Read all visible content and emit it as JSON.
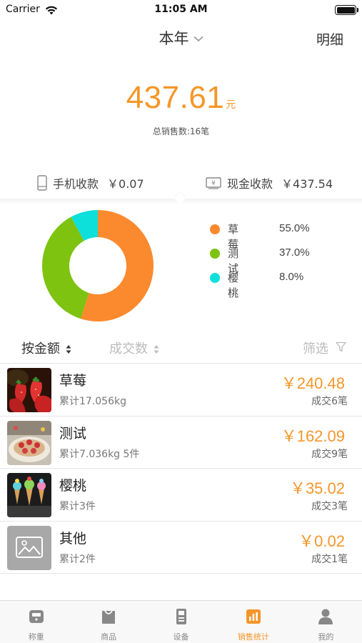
{
  "status_bar": {
    "carrier": "Carrier",
    "time": "11:05 AM"
  },
  "nav": {
    "period": "本年",
    "detail": "明细"
  },
  "summary": {
    "amount": "437.61",
    "unit": "元",
    "total_count": "总销售数:16笔"
  },
  "payments": {
    "mobile_label": "手机收款",
    "mobile_value": "￥0.07",
    "cash_label": "现金收款",
    "cash_value": "￥437.54"
  },
  "chart_data": {
    "type": "pie",
    "categories": [
      "草莓",
      "测试",
      "樱桃"
    ],
    "values": [
      55.0,
      37.0,
      8.0
    ],
    "labels": [
      "55.0%",
      "37.0%",
      "8.0%"
    ],
    "colors": [
      "#fb8a2e",
      "#7dc30f",
      "#0ddfdb"
    ],
    "title": "",
    "legend_position": "right"
  },
  "sort": {
    "by_amount": "按金额",
    "by_count": "成交数",
    "filter": "筛选"
  },
  "products": [
    {
      "name": "草莓",
      "sub": "累计17.056kg",
      "amount": "￥240.48",
      "deals": "成交6笔"
    },
    {
      "name": "测试",
      "sub": "累计7.036kg 5件",
      "amount": "￥162.09",
      "deals": "成交9笔"
    },
    {
      "name": "樱桃",
      "sub": "累计3件",
      "amount": "￥35.02",
      "deals": "成交3笔"
    },
    {
      "name": "其他",
      "sub": "累计2件",
      "amount": "￥0.02",
      "deals": "成交1笔"
    }
  ],
  "tabs": [
    {
      "label": "称重",
      "icon": "scale-icon"
    },
    {
      "label": "商品",
      "icon": "bag-icon"
    },
    {
      "label": "设备",
      "icon": "device-icon"
    },
    {
      "label": "销售统计",
      "icon": "bar-chart-icon",
      "active": true
    },
    {
      "label": "我的",
      "icon": "person-icon"
    }
  ],
  "colors": {
    "accent": "#f5962a",
    "text": "#333333",
    "muted": "#bbbbbb"
  }
}
